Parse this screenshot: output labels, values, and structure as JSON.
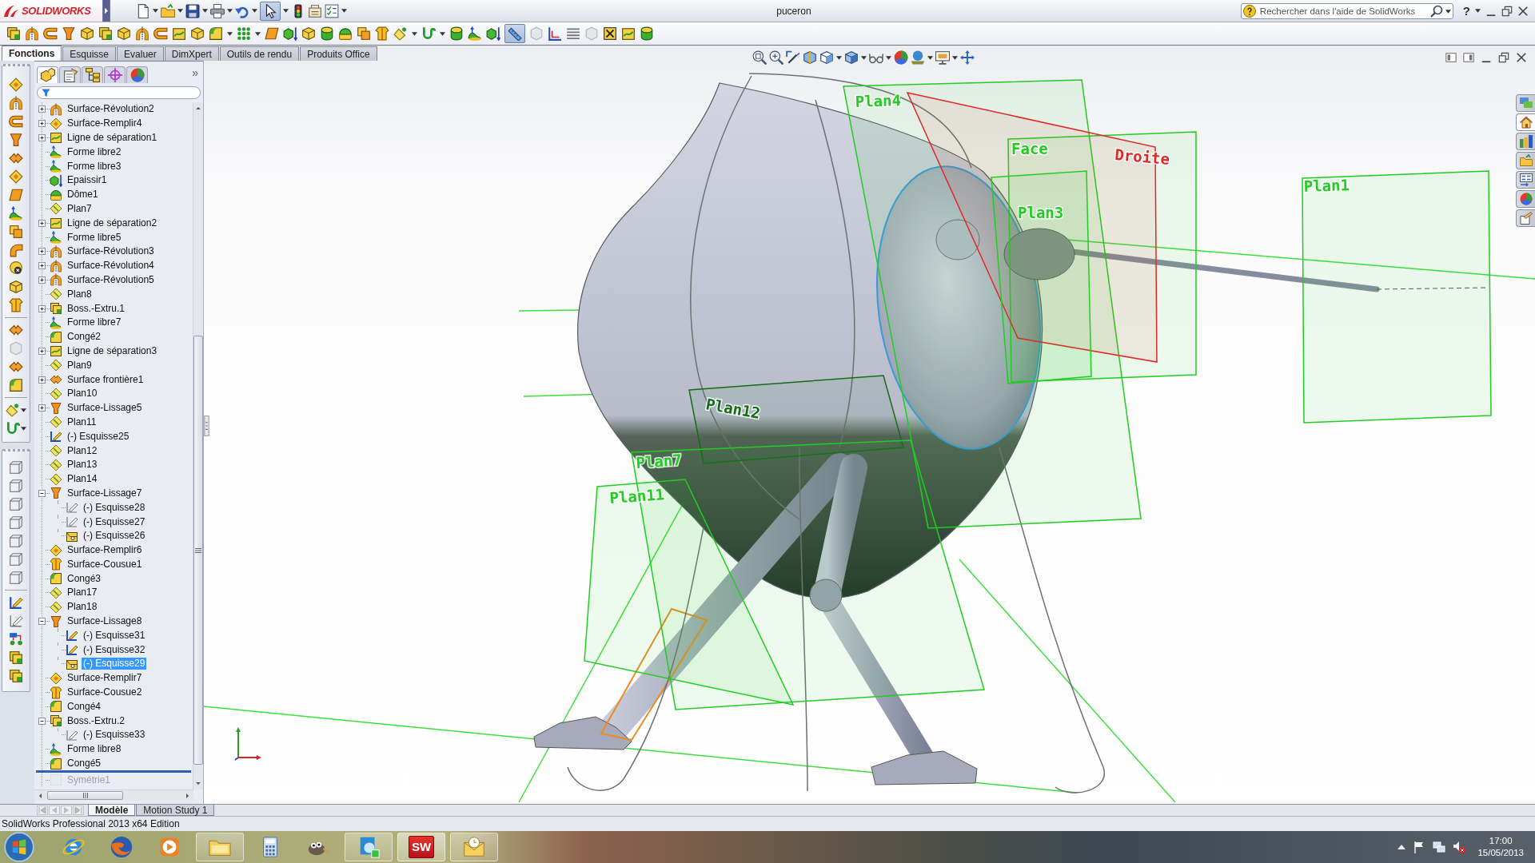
{
  "title_bar": {
    "brand": "SOLIDWORKS",
    "document_title": "puceron",
    "search": {
      "placeholder": "Rechercher dans l'aide de SolidWorks"
    },
    "help_glyph": "?"
  },
  "standard_toolbar": {
    "pointer_on": true
  },
  "feature_toolbar": {
    "ruler_on": true
  },
  "command_tabs": [
    {
      "label": "Fonctions",
      "selected": true
    },
    {
      "label": "Esquisse",
      "selected": false
    },
    {
      "label": "Evaluer",
      "selected": false
    },
    {
      "label": "DimXpert",
      "selected": false
    },
    {
      "label": "Outils de rendu",
      "selected": false
    },
    {
      "label": "Produits Office",
      "selected": false
    }
  ],
  "feature_manager": {
    "panel_tabs": [
      {
        "selected": true
      },
      {
        "selected": false
      },
      {
        "selected": false
      },
      {
        "selected": false
      },
      {
        "selected": false
      }
    ],
    "more_glyph": "»",
    "tree": [
      {
        "label": "Surface-Révolution2",
        "kind": "revolve",
        "expanded": false,
        "selected": false,
        "rolled_back": false
      },
      {
        "label": "Surface-Remplir4",
        "kind": "fill",
        "expanded": false,
        "selected": false,
        "rolled_back": false
      },
      {
        "label": "Ligne de séparation1",
        "kind": "splitline",
        "expanded": false,
        "selected": false,
        "rolled_back": false
      },
      {
        "label": "Forme libre2",
        "kind": "freeform",
        "selected": false,
        "rolled_back": false
      },
      {
        "label": "Forme libre3",
        "kind": "freeform",
        "selected": false,
        "rolled_back": false
      },
      {
        "label": "Epaissir1",
        "kind": "thicken",
        "selected": false,
        "rolled_back": false
      },
      {
        "label": "Dôme1",
        "kind": "dome",
        "selected": false,
        "rolled_back": false
      },
      {
        "label": "Plan7",
        "kind": "plane",
        "selected": false,
        "rolled_back": false
      },
      {
        "label": "Ligne de séparation2",
        "kind": "splitline",
        "expanded": false,
        "selected": false,
        "rolled_back": false
      },
      {
        "label": "Forme libre5",
        "kind": "freeform",
        "selected": false,
        "rolled_back": false
      },
      {
        "label": "Surface-Révolution3",
        "kind": "revolve",
        "expanded": false,
        "selected": false,
        "rolled_back": false
      },
      {
        "label": "Surface-Révolution4",
        "kind": "revolve",
        "expanded": false,
        "selected": false,
        "rolled_back": false
      },
      {
        "label": "Surface-Révolution5",
        "kind": "revolve",
        "expanded": false,
        "selected": false,
        "rolled_back": false
      },
      {
        "label": "Plan8",
        "kind": "plane",
        "selected": false,
        "rolled_back": false
      },
      {
        "label": "Boss.-Extru.1",
        "kind": "extrude",
        "expanded": false,
        "selected": false,
        "rolled_back": false
      },
      {
        "label": "Forme libre7",
        "kind": "freeform",
        "selected": false,
        "rolled_back": false
      },
      {
        "label": "Congé2",
        "kind": "fillet",
        "selected": false,
        "rolled_back": false
      },
      {
        "label": "Ligne de séparation3",
        "kind": "splitline",
        "expanded": false,
        "selected": false,
        "rolled_back": false
      },
      {
        "label": "Plan9",
        "kind": "plane",
        "selected": false,
        "rolled_back": false
      },
      {
        "label": "Surface frontière1",
        "kind": "boundary",
        "expanded": false,
        "selected": false,
        "rolled_back": false
      },
      {
        "label": "Plan10",
        "kind": "plane",
        "selected": false,
        "rolled_back": false
      },
      {
        "label": "Surface-Lissage5",
        "kind": "loft",
        "expanded": false,
        "selected": false,
        "rolled_back": false
      },
      {
        "label": "Plan11",
        "kind": "plane",
        "selected": false,
        "rolled_back": false
      },
      {
        "label": "(-) Esquisse25",
        "kind": "sketch",
        "selected": false,
        "rolled_back": false
      },
      {
        "label": "Plan12",
        "kind": "plane",
        "selected": false,
        "rolled_back": false
      },
      {
        "label": "Plan13",
        "kind": "plane",
        "selected": false,
        "rolled_back": false
      },
      {
        "label": "Plan14",
        "kind": "plane",
        "selected": false,
        "rolled_back": false
      },
      {
        "label": "Surface-Lissage7",
        "kind": "loft",
        "expanded": true,
        "selected": false,
        "rolled_back": false,
        "children": [
          {
            "label": "(-) Esquisse28",
            "kind": "ghostsketch",
            "selected": false
          },
          {
            "label": "(-) Esquisse27",
            "kind": "ghostsketch",
            "selected": false
          },
          {
            "label": "(-) Esquisse26",
            "kind": "facesketch",
            "selected": false
          }
        ]
      },
      {
        "label": "Surface-Remplir6",
        "kind": "fill",
        "selected": false,
        "rolled_back": false
      },
      {
        "label": "Surface-Cousue1",
        "kind": "knit",
        "selected": false,
        "rolled_back": false
      },
      {
        "label": "Congé3",
        "kind": "fillet",
        "selected": false,
        "rolled_back": false
      },
      {
        "label": "Plan17",
        "kind": "plane",
        "selected": false,
        "rolled_back": false
      },
      {
        "label": "Plan18",
        "kind": "plane",
        "selected": false,
        "rolled_back": false
      },
      {
        "label": "Surface-Lissage8",
        "kind": "loft",
        "expanded": true,
        "selected": false,
        "rolled_back": false,
        "children": [
          {
            "label": "(-) Esquisse31",
            "kind": "sketch",
            "selected": false
          },
          {
            "label": "(-) Esquisse32",
            "kind": "sketch",
            "selected": false
          },
          {
            "label": "(-) Esquisse29",
            "kind": "facesketch",
            "selected": true
          }
        ]
      },
      {
        "label": "Surface-Remplir7",
        "kind": "fill",
        "selected": false,
        "rolled_back": false
      },
      {
        "label": "Surface-Cousue2",
        "kind": "knit",
        "selected": false,
        "rolled_back": false
      },
      {
        "label": "Congé4",
        "kind": "fillet",
        "selected": false,
        "rolled_back": false
      },
      {
        "label": "Boss.-Extru.2",
        "kind": "extrude",
        "expanded": true,
        "selected": false,
        "rolled_back": false,
        "children": [
          {
            "label": "(-) Esquisse33",
            "kind": "ghostsketch",
            "selected": false
          }
        ]
      },
      {
        "label": "Forme libre8",
        "kind": "freeform",
        "selected": false,
        "rolled_back": false
      },
      {
        "label": "Congé5",
        "kind": "fillet",
        "selected": false,
        "rolled_back": false
      },
      {
        "label": "Symétrie1",
        "kind": "mirror",
        "selected": false,
        "rolled_back": true
      }
    ]
  },
  "viewport": {
    "plane_labels": [
      {
        "text": "Plan4",
        "color": "#22cc22"
      },
      {
        "text": "Face",
        "color": "#22cc22"
      },
      {
        "text": "Droite",
        "color": "#e02828"
      },
      {
        "text": "Plan1",
        "color": "#22cc22"
      },
      {
        "text": "Plan3",
        "color": "#22cc22"
      },
      {
        "text": "Plan12",
        "color": "#146c14"
      },
      {
        "text": "Plan7",
        "color": "#22cc22"
      },
      {
        "text": "Plan11",
        "color": "#22cc22"
      }
    ]
  },
  "task_pane_tabs": [
    {
      "selected": false
    },
    {
      "selected": true
    },
    {
      "selected": false
    },
    {
      "selected": false
    },
    {
      "selected": false
    },
    {
      "selected": false
    },
    {
      "selected": false
    }
  ],
  "bottom_tabs": [
    {
      "label": "Modèle",
      "selected": true
    },
    {
      "label": "Motion Study 1",
      "selected": false
    }
  ],
  "status_bar": {
    "text": "SolidWorks Professional 2013 x64 Edition"
  },
  "taskbar": {
    "app_badge": "SW",
    "time": "17:00",
    "date": "15/05/2013"
  }
}
